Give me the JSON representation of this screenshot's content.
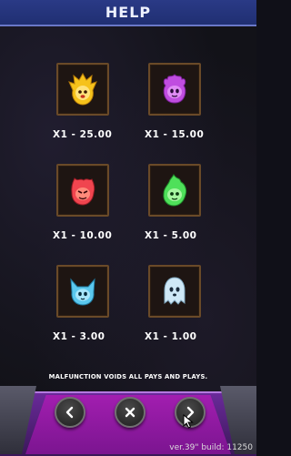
{
  "header": {
    "title": "HELP"
  },
  "symbols": [
    {
      "name": "gold-flame-spirit-icon",
      "payout": "X1 - 25.00",
      "color": "#f6c21b"
    },
    {
      "name": "purple-flame-spirit-icon",
      "payout": "X1 - 15.00",
      "color": "#c04de0"
    },
    {
      "name": "red-flame-spirit-icon",
      "payout": "X1 - 10.00",
      "color": "#f0454f"
    },
    {
      "name": "green-flame-spirit-icon",
      "payout": "X1 - 5.00",
      "color": "#4fe05a"
    },
    {
      "name": "blue-horned-spirit-icon",
      "payout": "X1 - 3.00",
      "color": "#5bc8ee"
    },
    {
      "name": "white-ghost-spirit-icon",
      "payout": "X1 - 1.00",
      "color": "#cfe8f6"
    }
  ],
  "footer": {
    "note": "MALFUNCTION VOIDS ALL PAYS AND PLAYS."
  },
  "controls": {
    "prev_icon": "chevron-left-icon",
    "close_icon": "close-icon",
    "next_icon": "chevron-right-icon"
  },
  "version_text": "ver.39\" build: 11250"
}
